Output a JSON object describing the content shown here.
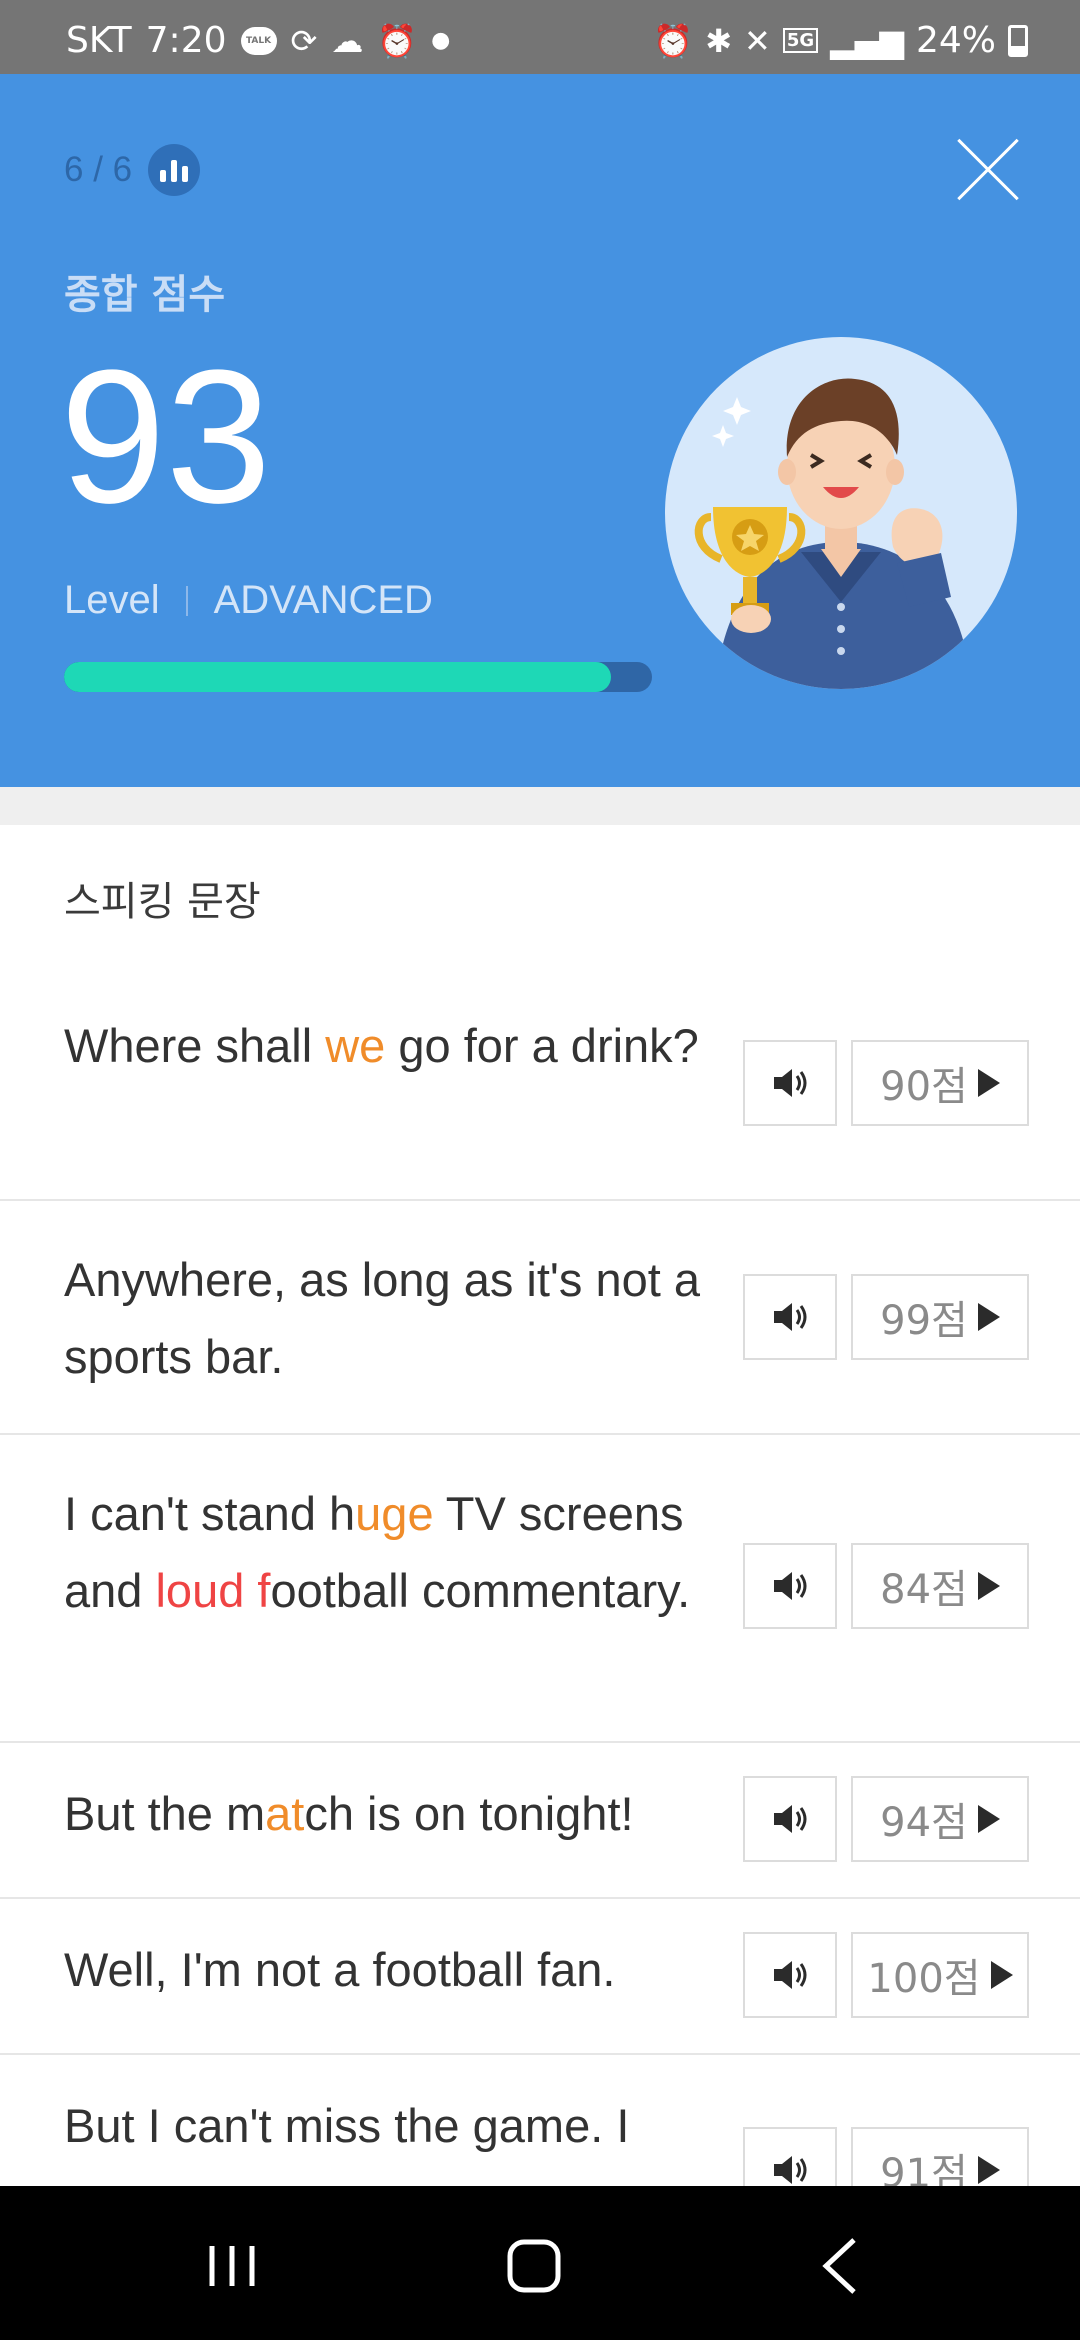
{
  "status_bar": {
    "carrier": "SKT",
    "time": "7:20",
    "talk_badge": "TALK",
    "network": "5G",
    "battery": "24%",
    "icons_left": [
      "kakaotalk-icon",
      "sync-icon",
      "weather-icon",
      "alarm-icon",
      "dot-icon"
    ],
    "icons_right": [
      "alarm-icon",
      "bluetooth-icon",
      "mute-icon",
      "5g-icon",
      "signal-icon",
      "battery-icon"
    ]
  },
  "header": {
    "page_count": "6 / 6",
    "score_title": "종합 점수",
    "score": "93",
    "level_label": "Level",
    "level_value": "ADVANCED",
    "level_progress": 0.93,
    "colors": {
      "background": "#4592e1",
      "progress_fill": "#1ed8b6",
      "progress_track": "#2f66a6"
    }
  },
  "section": {
    "title": "스피킹 문장"
  },
  "sentences": [
    {
      "parts": [
        [
          "Where shall ",
          ""
        ],
        [
          "we",
          "orange"
        ],
        [
          " go for a drink?",
          ""
        ]
      ],
      "score": "90점"
    },
    {
      "parts": [
        [
          "Anywhere, as long as it's not a sports bar.",
          ""
        ]
      ],
      "score": "99점"
    },
    {
      "parts": [
        [
          "I can't stand h",
          ""
        ],
        [
          "uge",
          "orange"
        ],
        [
          " TV screens and ",
          ""
        ],
        [
          "loud f",
          "red"
        ],
        [
          "ootball commentary.",
          ""
        ]
      ],
      "score": "84점"
    },
    {
      "parts": [
        [
          "But the m",
          ""
        ],
        [
          "at",
          "orange"
        ],
        [
          "ch is on tonight!",
          ""
        ]
      ],
      "score": "94점"
    },
    {
      "parts": [
        [
          "Well, I'm not a football fan.",
          ""
        ]
      ],
      "score": "100점"
    },
    {
      "parts": [
        [
          "But I can't miss the game. I",
          ""
        ]
      ],
      "score": "91점"
    }
  ]
}
